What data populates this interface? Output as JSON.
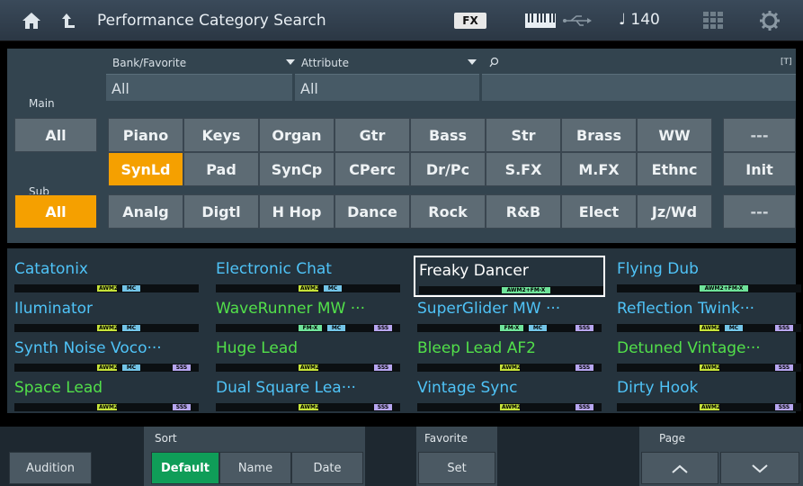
{
  "header": {
    "title": "Performance Category Search",
    "fx_label": "FX",
    "tempo": "♩ 140"
  },
  "filters": {
    "bank_label": "Bank/Favorite",
    "bank_value": "All",
    "attribute_label": "Attribute",
    "attribute_value": "All",
    "search_value": "",
    "search_suffix": "[T]"
  },
  "main": {
    "label": "Main",
    "buttons": [
      "All",
      "Piano",
      "Keys",
      "Organ",
      "Gtr",
      "Bass",
      "Str",
      "Brass",
      "WW",
      "---",
      "SynLd",
      "Pad",
      "SynCp",
      "CPerc",
      "Dr/Pc",
      "S.FX",
      "M.FX",
      "Ethnc",
      "Init"
    ],
    "selected": "SynLd"
  },
  "sub": {
    "label": "Sub",
    "buttons": [
      "All",
      "Analg",
      "Digtl",
      "H Hop",
      "Dance",
      "Rock",
      "R&B",
      "Elect",
      "Jz/Wd",
      "---"
    ],
    "selected": "All"
  },
  "performances": [
    {
      "name": "Catatonix",
      "color": "#4fc3f7",
      "tags": [
        "AWM2",
        "MC"
      ]
    },
    {
      "name": "Electronic Chat",
      "color": "#4fc3f7",
      "tags": [
        "AWM2",
        "MC"
      ]
    },
    {
      "name": "Freaky Dancer",
      "color": "#ffffff",
      "tags": [
        "AWM2+FM-X"
      ],
      "selected": true
    },
    {
      "name": "Flying Dub",
      "color": "#4fc3f7",
      "tags": [
        "AWM2+FM-X"
      ]
    },
    {
      "name": "Iluminator",
      "color": "#4fc3f7",
      "tags": [
        "AWM2",
        "MC"
      ]
    },
    {
      "name": "WaveRunner MW ···",
      "color": "#52e04a",
      "tags": [
        "FM-X",
        "MC",
        "SSS"
      ]
    },
    {
      "name": "SuperGlider MW ···",
      "color": "#4fc3f7",
      "tags": [
        "FM-X",
        "MC",
        "SSS"
      ]
    },
    {
      "name": "Reflection Twink···",
      "color": "#4fc3f7",
      "tags": [
        "AWM2",
        "MC",
        "SSS"
      ]
    },
    {
      "name": "Synth Noise Voco···",
      "color": "#4fc3f7",
      "tags": [
        "AWM2",
        "MC",
        "SSS"
      ]
    },
    {
      "name": "Huge Lead",
      "color": "#52e04a",
      "tags": [
        "AWM2",
        "SSS"
      ]
    },
    {
      "name": "Bleep Lead AF2",
      "color": "#52e04a",
      "tags": [
        "AWM2",
        "SSS"
      ]
    },
    {
      "name": "Detuned Vintage···",
      "color": "#52e04a",
      "tags": [
        "AWM2",
        "SSS"
      ]
    },
    {
      "name": "Space Lead",
      "color": "#52e04a",
      "tags": [
        "AWM2",
        "SSS"
      ]
    },
    {
      "name": "Dual Square Lea···",
      "color": "#4fc3f7",
      "tags": [
        "AWM2",
        "SSS"
      ]
    },
    {
      "name": "Vintage Sync",
      "color": "#4fc3f7",
      "tags": [
        "AWM2",
        "SSS"
      ]
    },
    {
      "name": "Dirty Hook",
      "color": "#4fc3f7",
      "tags": [
        "AWM2",
        "SSS"
      ]
    }
  ],
  "bottom": {
    "audition": "Audition",
    "sort_label": "Sort",
    "sort_default": "Default",
    "sort_name": "Name",
    "sort_date": "Date",
    "favorite_label": "Favorite",
    "favorite_set": "Set",
    "page_label": "Page",
    "page_up": "︿",
    "page_down": "﹀"
  }
}
